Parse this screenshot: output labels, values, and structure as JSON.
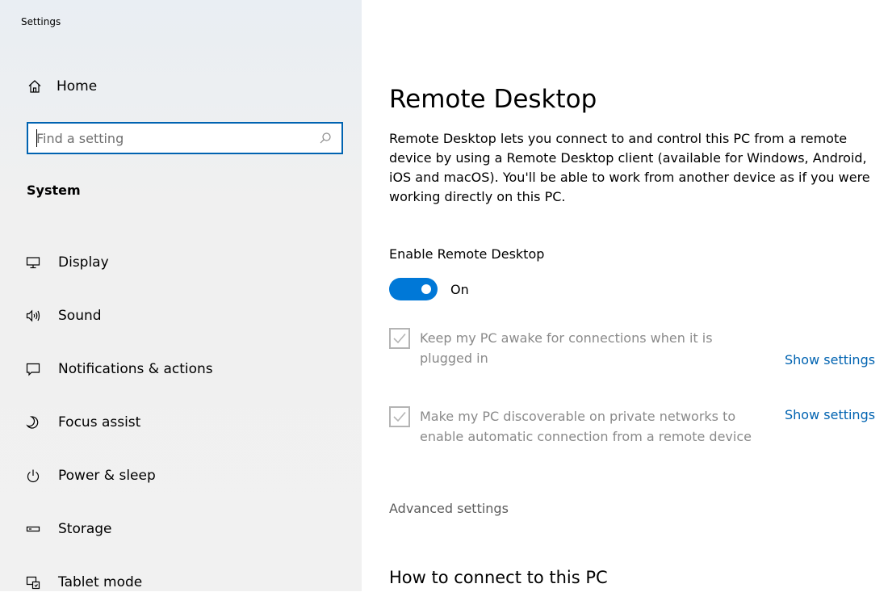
{
  "window": {
    "title": "Settings"
  },
  "sidebar": {
    "home_label": "Home",
    "search": {
      "placeholder": "Find a setting",
      "value": ""
    },
    "section_title": "System",
    "items": [
      {
        "label": "Display",
        "icon": "monitor-icon"
      },
      {
        "label": "Sound",
        "icon": "speaker-icon"
      },
      {
        "label": "Notifications & actions",
        "icon": "notification-icon"
      },
      {
        "label": "Focus assist",
        "icon": "moon-icon"
      },
      {
        "label": "Power & sleep",
        "icon": "power-icon"
      },
      {
        "label": "Storage",
        "icon": "storage-icon"
      },
      {
        "label": "Tablet mode",
        "icon": "tablet-mode-icon"
      }
    ]
  },
  "main": {
    "title": "Remote Desktop",
    "description": "Remote Desktop lets you connect to and control this PC from a remote device by using a Remote Desktop client (available for Windows, Android, iOS and macOS). You'll be able to work from another device as if you were working directly on this PC.",
    "enable_label": "Enable Remote Desktop",
    "toggle_state": "On",
    "options": [
      {
        "text": "Keep my PC awake for connections when it is plugged in",
        "checked": true,
        "link": "Show settings"
      },
      {
        "text": "Make my PC discoverable on private networks to enable automatic connection from a remote device",
        "checked": true,
        "link": "Show settings"
      }
    ],
    "advanced_link": "Advanced settings",
    "how_to_heading": "How to connect to this PC"
  },
  "colors": {
    "accent": "#0078d7",
    "link": "#0063b1",
    "disabled_text": "#8a8a8a"
  }
}
